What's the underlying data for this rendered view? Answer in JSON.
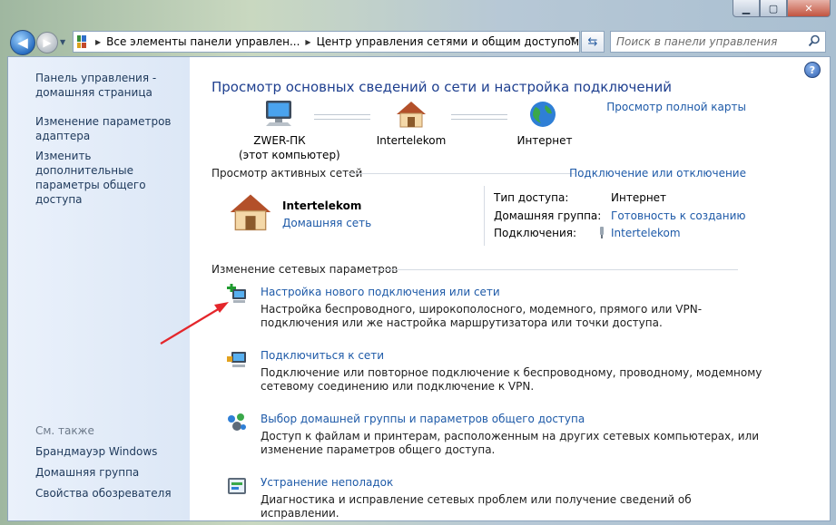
{
  "address_bar": {
    "crumbs": [
      "Все элементы панели управлен...",
      "Центр управления сетями и общим доступом"
    ]
  },
  "search": {
    "placeholder": "Поиск в панели управления"
  },
  "sidebar": {
    "home_line1": "Панель управления -",
    "home_line2": "домашняя страница",
    "link1_line1": "Изменение параметров",
    "link1_line2": "адаптера",
    "link2_line1": "Изменить дополнительные",
    "link2_line2": "параметры общего доступа",
    "see_also": "См. также",
    "see_also_items": [
      "Брандмауэр Windows",
      "Домашняя группа",
      "Свойства обозревателя"
    ]
  },
  "main": {
    "title": "Просмотр основных сведений о сети и настройка подключений",
    "full_map": "Просмотр полной карты",
    "map": {
      "computer_name": "ZWER-ПК",
      "computer_sub": "(этот компьютер)",
      "network": "Intertelekom",
      "internet": "Интернет"
    },
    "active_header": "Просмотр активных сетей",
    "connect_disconnect": "Подключение или отключение",
    "active_network": {
      "name": "Intertelekom",
      "type": "Домашняя сеть",
      "access_label": "Тип доступа:",
      "access_value": "Интернет",
      "homegroup_label": "Домашняя группа:",
      "homegroup_value": "Готовность к созданию",
      "connections_label": "Подключения:",
      "connections_value": "Intertelekom"
    },
    "change_header": "Изменение сетевых параметров",
    "tasks": [
      {
        "title": "Настройка нового подключения или сети",
        "desc": "Настройка беспроводного, широкополосного, модемного, прямого или VPN-подключения или же настройка маршрутизатора или точки доступа."
      },
      {
        "title": "Подключиться к сети",
        "desc": "Подключение или повторное подключение к беспроводному, проводному, модемному сетевому соединению или подключение к VPN."
      },
      {
        "title": "Выбор домашней группы и параметров общего доступа",
        "desc": "Доступ к файлам и принтерам, расположенным на других сетевых компьютерах, или изменение параметров общего доступа."
      },
      {
        "title": "Устранение неполадок",
        "desc": "Диагностика и исправление сетевых проблем или получение сведений об исправлении."
      }
    ]
  }
}
